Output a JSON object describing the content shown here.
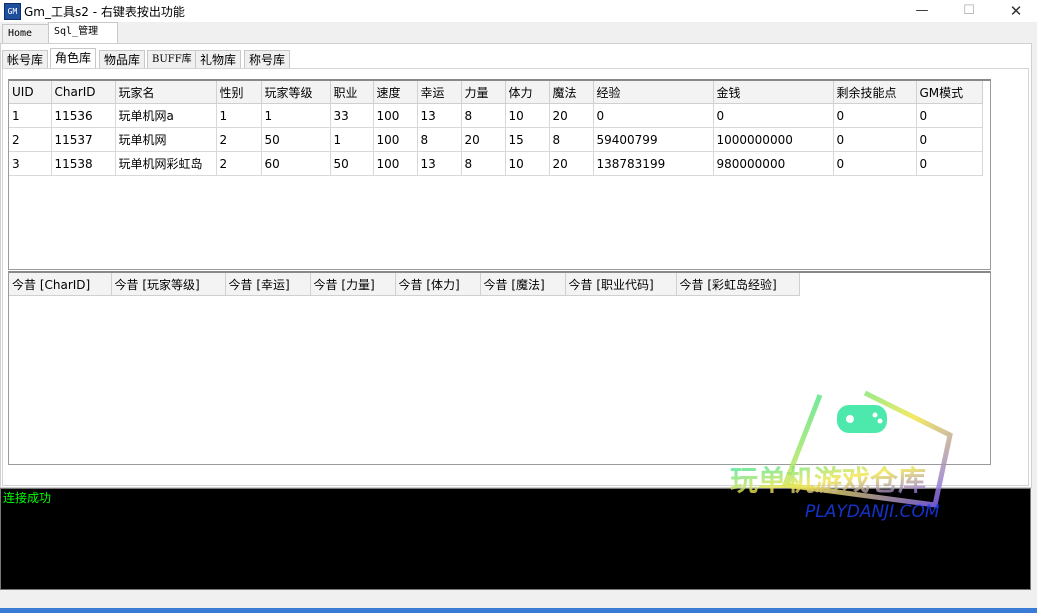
{
  "window": {
    "title": "Gm_工具s2 - 右键表按出功能",
    "icon_text": "GM",
    "minimize": "—",
    "maximize": "☐",
    "close": "✕"
  },
  "top_tabs": [
    {
      "label": "Home"
    },
    {
      "label": "Sql_管理"
    }
  ],
  "sub_tabs": [
    {
      "label": "帐号库"
    },
    {
      "label": "角色库"
    },
    {
      "label": "物品库"
    },
    {
      "label": "BUFF库"
    },
    {
      "label": "礼物库"
    },
    {
      "label": "称号库"
    }
  ],
  "grid1": {
    "columns": [
      "UID",
      "CharID",
      "玩家名",
      "性别",
      "玩家等级",
      "职业",
      "速度",
      "幸运",
      "力量",
      "体力",
      "魔法",
      "经验",
      "金钱",
      "剩余技能点",
      "GM模式"
    ],
    "rows": [
      [
        "1",
        "11536",
        "玩单机网a",
        "1",
        "1",
        "33",
        "100",
        "13",
        "8",
        "10",
        "20",
        "0",
        "0",
        "0",
        "0"
      ],
      [
        "2",
        "11537",
        "玩单机网",
        "2",
        "50",
        "1",
        "100",
        "8",
        "20",
        "15",
        "8",
        "59400799",
        "1000000000",
        "0",
        "0"
      ],
      [
        "3",
        "11538",
        "玩单机网彩虹岛",
        "2",
        "60",
        "50",
        "100",
        "13",
        "8",
        "10",
        "20",
        "138783199",
        "980000000",
        "0",
        "0"
      ]
    ]
  },
  "grid2": {
    "columns": [
      "今昔 [CharID]",
      "今昔 [玩家等级]",
      "今昔 [幸运]",
      "今昔 [力量]",
      "今昔 [体力]",
      "今昔 [魔法]",
      "今昔 [职业代码]",
      "今昔 [彩虹岛经验]"
    ]
  },
  "log": {
    "line": "连接成功"
  },
  "watermark": {
    "text_cn": "玩单机游戏仓库",
    "text_en": "PLAYDANJI.COM"
  }
}
